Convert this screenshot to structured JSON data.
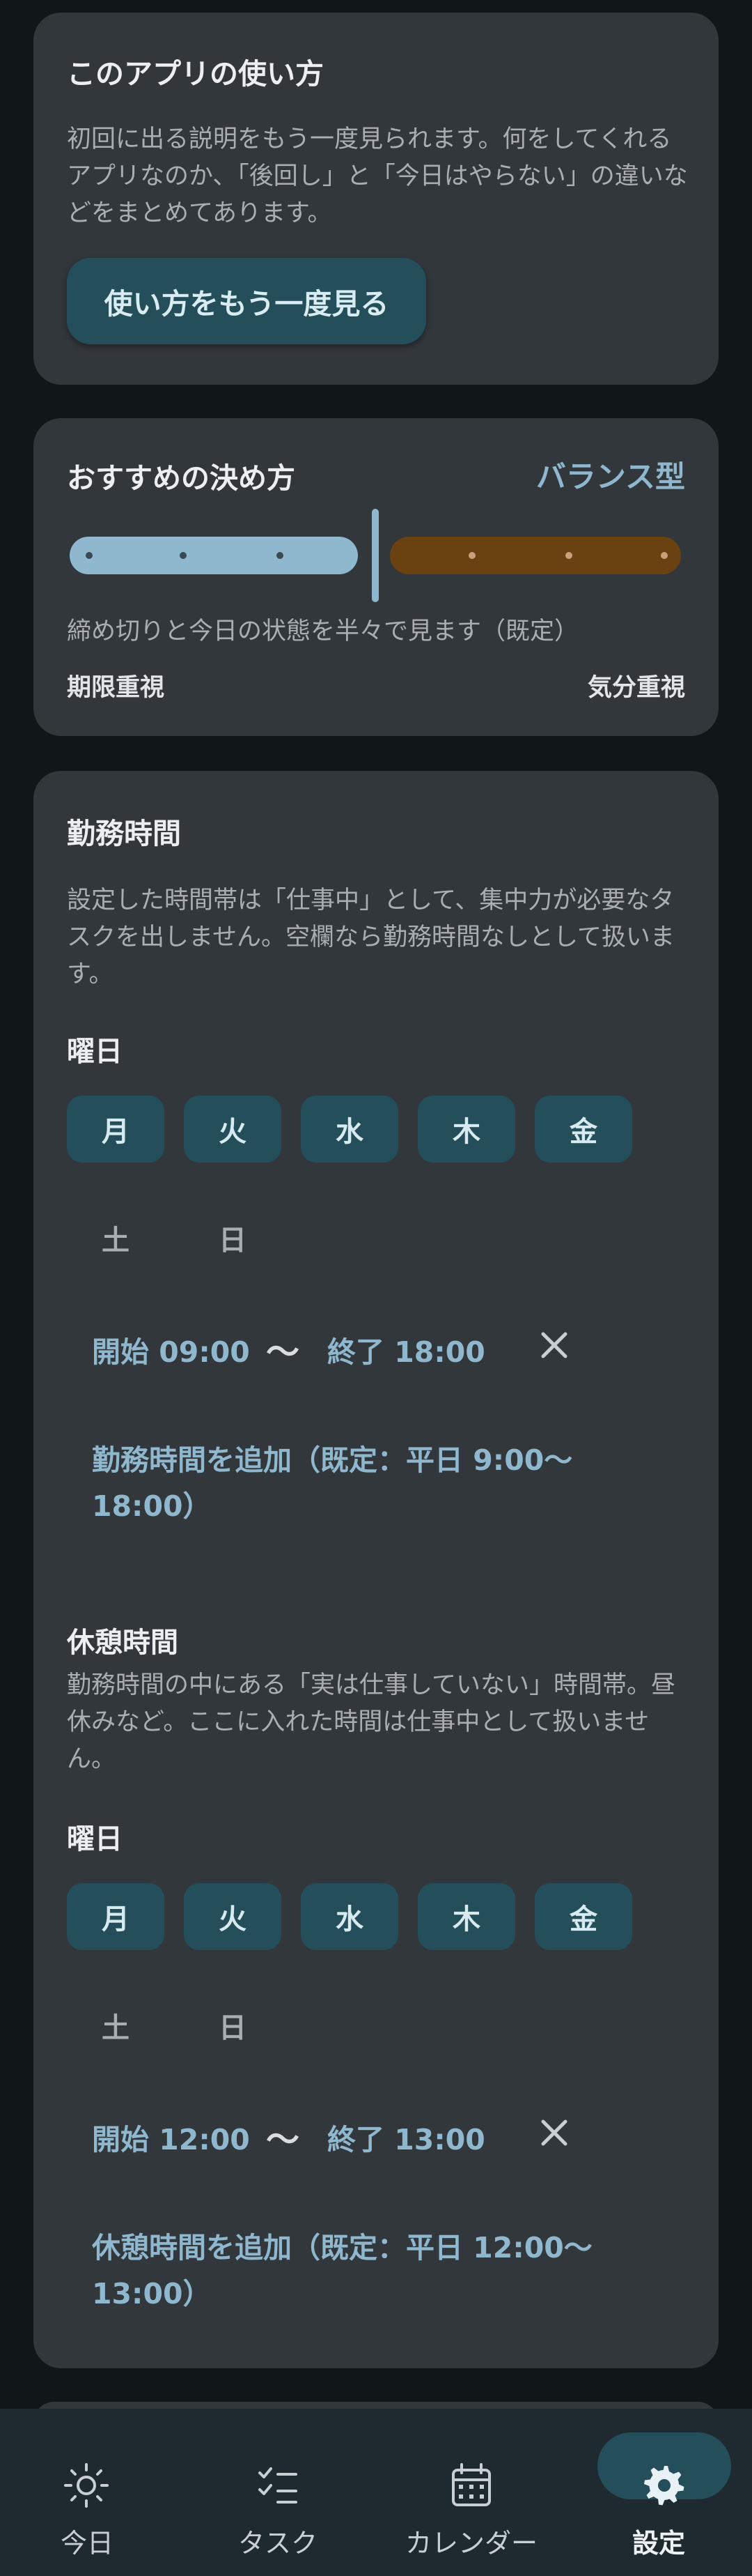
{
  "help": {
    "title": "このアプリの使い方",
    "desc": "初回に出る説明をもう一度見られます。何をしてくれるアプリなのか、「後回し」と「今日はやらない」の違いなどをまとめてあります。",
    "button_label": "使い方をもう一度見る"
  },
  "recommend": {
    "title": "おすすめの決め方",
    "mode": "バランス型",
    "slider_value": 0.5,
    "desc": "締め切りと今日の状態を半々で見ます（既定）",
    "left_label": "期限重視",
    "right_label": "気分重視"
  },
  "work": {
    "title": "勤務時間",
    "desc": "設定した時間帯は「仕事中」として、集中力が必要なタスクを出しません。空欄なら勤務時間なしとして扱います。",
    "days_label": "曜日",
    "days": [
      {
        "label": "月",
        "selected": true
      },
      {
        "label": "火",
        "selected": true
      },
      {
        "label": "水",
        "selected": true
      },
      {
        "label": "木",
        "selected": true
      },
      {
        "label": "金",
        "selected": true
      },
      {
        "label": "土",
        "selected": false
      },
      {
        "label": "日",
        "selected": false
      }
    ],
    "start": "開始 09:00",
    "separator": "〜",
    "end": "終了 18:00",
    "add_label": "勤務時間を追加（既定：平日 9:00〜18:00）"
  },
  "break": {
    "title": "休憩時間",
    "desc": "勤務時間の中にある「実は仕事していない」時間帯。昼休みなど。ここに入れた時間は仕事中として扱いません。",
    "days_label": "曜日",
    "days": [
      {
        "label": "月",
        "selected": true
      },
      {
        "label": "火",
        "selected": true
      },
      {
        "label": "水",
        "selected": true
      },
      {
        "label": "木",
        "selected": true
      },
      {
        "label": "金",
        "selected": true
      },
      {
        "label": "土",
        "selected": false
      },
      {
        "label": "日",
        "selected": false
      }
    ],
    "start": "開始 12:00",
    "separator": "〜",
    "end": "終了 13:00",
    "add_label": "休憩時間を追加（既定：平日 12:00〜13:00）"
  },
  "nav": {
    "items": [
      {
        "label": "今日",
        "icon": "sun-icon"
      },
      {
        "label": "タスク",
        "icon": "checklist-icon"
      },
      {
        "label": "カレンダー",
        "icon": "calendar-icon"
      },
      {
        "label": "設定",
        "icon": "gear-icon"
      }
    ],
    "active": "設定"
  },
  "colors": {
    "background": "#111618",
    "card": "#32373b",
    "accent": "#8fb7ce",
    "button_bg": "#244e5a",
    "mood_bar": "#6a4212"
  }
}
